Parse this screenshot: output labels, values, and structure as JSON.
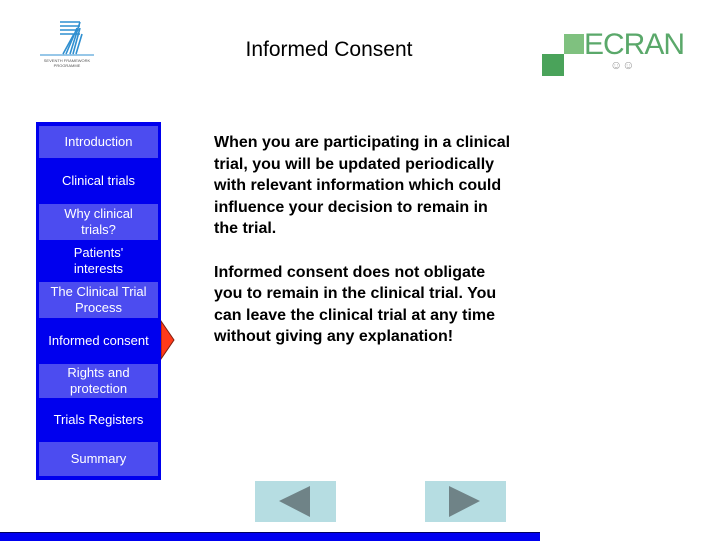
{
  "header": {
    "title": "Informed Consent",
    "left_logo": {
      "name": "fp7-logo",
      "caption_line1": "SEVENTH FRAMEWORK",
      "caption_line2": "PROGRAMME"
    },
    "right_logo": {
      "name": "ecran-logo",
      "text": "ECRAN"
    }
  },
  "sidebar": {
    "items": [
      {
        "label": "Introduction",
        "style": "light"
      },
      {
        "label": "Clinical trials",
        "style": "dark"
      },
      {
        "label": "Why clinical trials?",
        "style": "light"
      },
      {
        "label": "Patients' interests",
        "style": "dark"
      },
      {
        "label": "The Clinical Trial Process",
        "style": "light"
      },
      {
        "label": "Informed consent",
        "style": "dark",
        "active": true
      },
      {
        "label": "Rights and protection",
        "style": "light"
      },
      {
        "label": "Trials Registers",
        "style": "dark"
      },
      {
        "label": "Summary",
        "style": "light"
      }
    ]
  },
  "content": {
    "paragraphs": [
      "When you are participating in a clinical trial, you will be updated periodically with relevant information which could influence your decision to remain in the trial.",
      "Informed consent does not obligate you to remain in the clinical trial. You can leave the clinical trial at any time without giving any explanation!"
    ]
  },
  "navigation": {
    "previous_icon": "triangle-left-icon",
    "next_icon": "triangle-right-icon"
  },
  "colors": {
    "sidebar_dark": "#0000ee",
    "sidebar_light": "#4c4cf0",
    "pointer": "#ff3a1a",
    "nav_button_bg": "#b6dde2",
    "nav_arrow": "#6f8387",
    "ecran_green": "#5aa86a"
  }
}
